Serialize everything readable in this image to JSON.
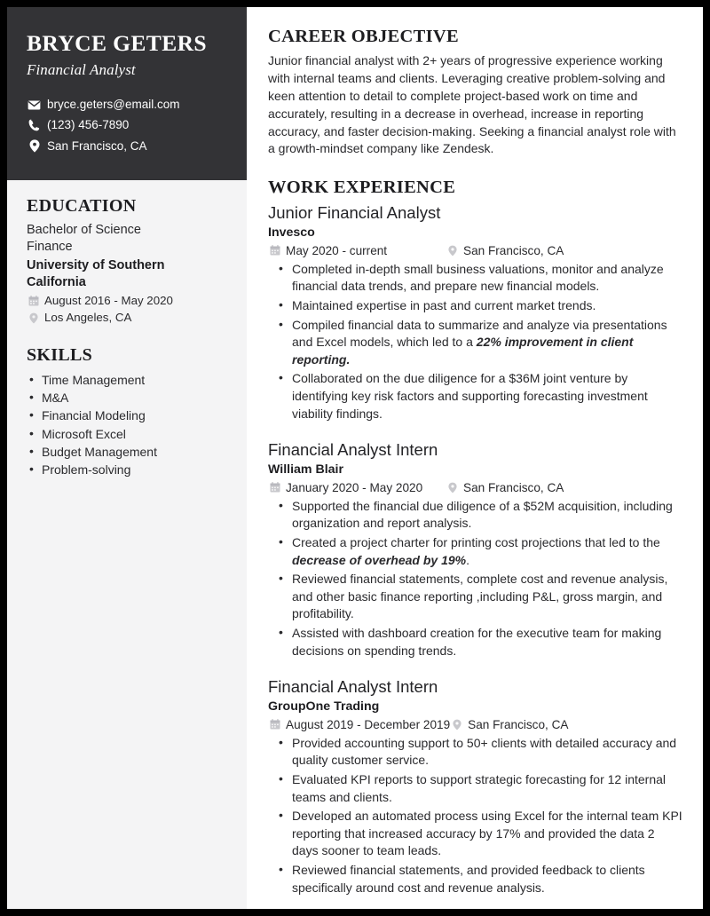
{
  "sidebar": {
    "name": "BRYCE GETERS",
    "title": "Financial Analyst",
    "contact": [
      {
        "icon": "envelope-icon",
        "value": "bryce.geters@email.com"
      },
      {
        "icon": "phone-icon",
        "value": "(123) 456-7890"
      },
      {
        "icon": "map-pin-icon",
        "value": "San Francisco, CA"
      }
    ],
    "education": {
      "heading": "EDUCATION",
      "degree": "Bachelor of Science",
      "field": "Finance",
      "school": "University of Southern California",
      "dates": "August 2016 - May 2020",
      "location": "Los Angeles, CA"
    },
    "skills": {
      "heading": "SKILLS",
      "items": [
        "Time Management",
        "M&A",
        "Financial Modeling",
        "Microsoft Excel",
        "Budget Management",
        "Problem-solving"
      ]
    }
  },
  "main": {
    "objective": {
      "heading": "CAREER OBJECTIVE",
      "text": "Junior financial analyst with 2+ years of progressive experience working with internal teams and clients. Leveraging creative problem-solving and keen attention to detail to complete project-based work on time and accurately, resulting in a decrease in overhead, increase in reporting accuracy, and faster decision-making. Seeking a financial analyst role with a growth-mindset company like Zendesk."
    },
    "work": {
      "heading": "WORK EXPERIENCE",
      "jobs": [
        {
          "title": "Junior Financial Analyst",
          "company": "Invesco",
          "dates": "May 2020 - current",
          "location": "San Francisco, CA",
          "bullets": [
            {
              "text": "Completed in-depth small business valuations, monitor and analyze financial data trends, and prepare new financial models."
            },
            {
              "text": "Maintained expertise in past and current market trends."
            },
            {
              "pre": "Compiled financial data to summarize and analyze via presentations and Excel models, which led to a ",
              "em": "22% improvement in client reporting.",
              "post": ""
            },
            {
              "text": "Collaborated on the due diligence for a $36M joint venture by identifying key risk factors and supporting forecasting investment viability findings."
            }
          ]
        },
        {
          "title": "Financial Analyst Intern",
          "company": "William Blair",
          "dates": "January 2020 - May 2020",
          "location": "San Francisco, CA",
          "bullets": [
            {
              "text": "Supported the financial due diligence of a $52M acquisition, including organization and report analysis."
            },
            {
              "pre": "Created a project charter for printing cost projections that led to the ",
              "em": "decrease of overhead by 19%",
              "post": "."
            },
            {
              "text": "Reviewed financial statements, complete cost and revenue analysis, and other basic finance reporting ,including P&L, gross margin, and profitability."
            },
            {
              "text": "Assisted with dashboard creation for the executive team for making decisions on spending trends."
            }
          ]
        },
        {
          "title": "Financial Analyst Intern",
          "company": "GroupOne Trading",
          "dates": "August 2019 - December 2019",
          "location": "San Francisco, CA",
          "bullets": [
            {
              "text": "Provided accounting support to 50+ clients with detailed accuracy and quality customer service."
            },
            {
              "text": "Evaluated KPI reports to support strategic forecasting for 12 internal teams and clients."
            },
            {
              "text": "Developed an automated process using Excel for the internal team KPI reporting that increased accuracy by 17% and provided the data 2 days sooner to team leads."
            },
            {
              "text": "Reviewed financial statements, and provided feedback to clients specifically around cost and revenue analysis."
            }
          ]
        }
      ]
    }
  },
  "colors": {
    "header_background": "#333336",
    "sidebar_background": "#f4f4f5",
    "page_border": "#000000",
    "text_primary": "#2a2a2d",
    "icon_muted": "#c8c8cc"
  }
}
